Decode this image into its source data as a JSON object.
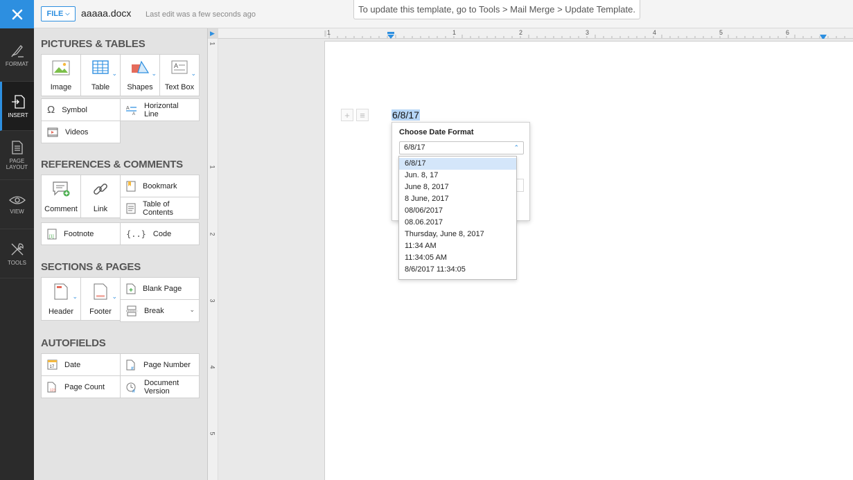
{
  "rail": {
    "items": [
      {
        "label": "FORMAT",
        "icon": "format-brush-icon"
      },
      {
        "label": "INSERT",
        "icon": "insert-icon"
      },
      {
        "label": "PAGE LAYOUT",
        "icon": "page-layout-icon"
      },
      {
        "label": "VIEW",
        "icon": "eye-icon"
      },
      {
        "label": "TOOLS",
        "icon": "tools-icon"
      }
    ]
  },
  "topbar": {
    "file_label": "FILE",
    "doc_title": "aaaaa.docx",
    "last_edit": "Last edit was a few seconds ago",
    "banner": "To update this template, go to Tools > Mail Merge > Update Template."
  },
  "panel": {
    "pictures_title": "PICTURES & TABLES",
    "image": "Image",
    "table": "Table",
    "shapes": "Shapes",
    "textbox": "Text Box",
    "symbol": "Symbol",
    "hline_1": "Horizontal",
    "hline_2": "Line",
    "videos": "Videos",
    "refs_title": "REFERENCES & COMMENTS",
    "comment": "Comment",
    "link": "Link",
    "bookmark": "Bookmark",
    "toc_1": "Table of",
    "toc_2": "Contents",
    "footnote": "Footnote",
    "code": "Code",
    "sections_title": "SECTIONS & PAGES",
    "header": "Header",
    "footer": "Footer",
    "blank_page": "Blank Page",
    "break": "Break",
    "autofields_title": "AUTOFIELDS",
    "date": "Date",
    "page_number": "Page Number",
    "page_count": "Page Count",
    "docver_1": "Document",
    "docver_2": "Version"
  },
  "document": {
    "date_text": "6/8/17"
  },
  "popup": {
    "title": "Choose Date Format",
    "selected": "6/8/17",
    "options": [
      "6/8/17",
      "Jun. 8, 17",
      "June 8, 2017",
      "8 June, 2017",
      "08/06/2017",
      "08.06.2017",
      "Thursday, June 8, 2017",
      "11:34 AM",
      "11:34:05 AM",
      "8/6/2017 11:34:05"
    ],
    "highlighted_index": 0
  },
  "ruler": {
    "h_numbers": [
      "1",
      "1",
      "2",
      "3",
      "4",
      "5",
      "6"
    ],
    "v_numbers": [
      "1",
      "1",
      "2",
      "3",
      "4",
      "5"
    ]
  },
  "colors": {
    "accent": "#2d8fe0",
    "rail_bg": "#2b2b2b",
    "selection": "#b6d6f7"
  }
}
